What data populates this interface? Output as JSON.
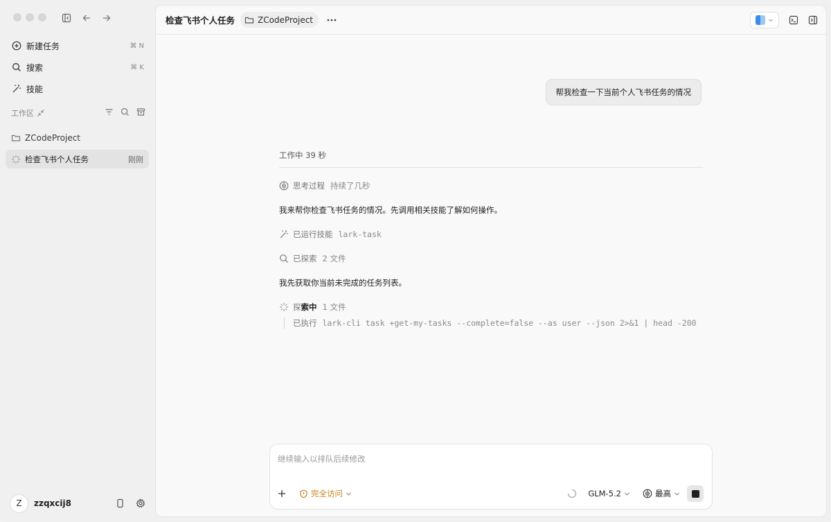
{
  "sidebar": {
    "new_task": {
      "label": "新建任务",
      "shortcut": "⌘ N",
      "icon": "new-task-icon"
    },
    "search": {
      "label": "搜索",
      "shortcut": "⌘ K",
      "icon": "search-icon"
    },
    "skills": {
      "label": "技能",
      "icon": "magic-wand-icon"
    },
    "workspace_label": "工作区",
    "project": {
      "label": "ZCodeProject",
      "icon": "folder-icon"
    },
    "task": {
      "label": "检查飞书个人任务",
      "time": "刚刚",
      "icon": "spinner-icon"
    },
    "user": {
      "initial": "Z",
      "name": "zzqxcij8"
    }
  },
  "topbar": {
    "title": "检查飞书个人任务",
    "project": "ZCodeProject"
  },
  "conversation": {
    "user_message": "帮我检查一下当前个人飞书任务的情况",
    "working": "工作中 39 秒",
    "thinking": {
      "label": "思考过程",
      "sub": "持续了几秒"
    },
    "msg1": "我来帮你检查飞书任务的情况。先调用相关技能了解如何操作。",
    "skill_run": {
      "label": "已运行技能",
      "name": "lark-task"
    },
    "explored": {
      "label": "已探索",
      "sub": "2 文件"
    },
    "msg2": "我先获取你当前未完成的任务列表。",
    "exploring": {
      "label_a": "探",
      "label_b": "索中",
      "sub": "1 文件"
    },
    "exec": {
      "label": "已执行",
      "command": "lark-cli task +get-my-tasks --complete=false --as user --json 2>&1 | head -200"
    }
  },
  "composer": {
    "placeholder": "继续输入以排队后续修改",
    "access": "完全访问",
    "model": "GLM-5.2",
    "effort": "最高"
  },
  "colors": {
    "accent_orange": "#c9821a",
    "selected_bg": "#e3e3e3"
  }
}
